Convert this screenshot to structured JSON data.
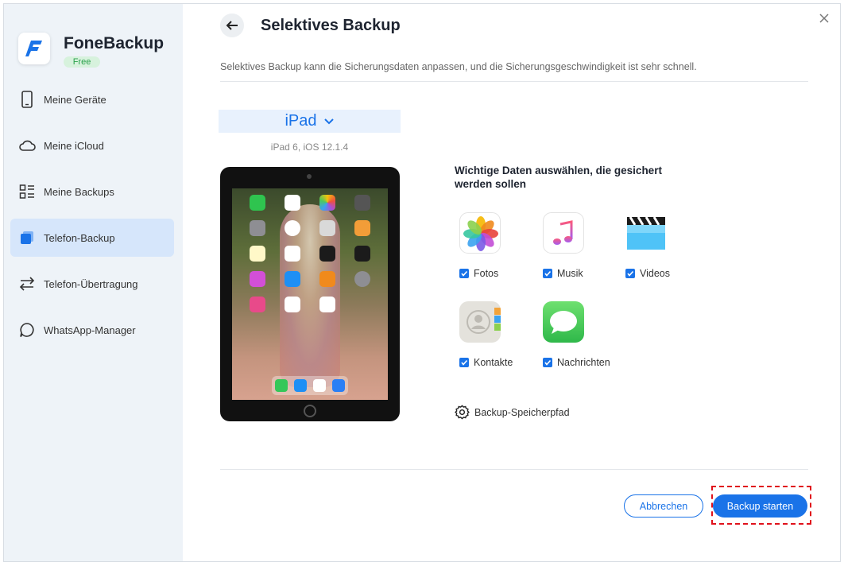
{
  "app": {
    "name": "FoneBackup",
    "badge": "Free"
  },
  "sidebar": {
    "items": [
      {
        "label": "Meine Geräte",
        "icon": "phone-icon",
        "active": false
      },
      {
        "label": "Meine iCloud",
        "icon": "cloud-icon",
        "active": false
      },
      {
        "label": "Meine Backups",
        "icon": "list-icon",
        "active": false
      },
      {
        "label": "Telefon-Backup",
        "icon": "backup-icon",
        "active": true
      },
      {
        "label": "Telefon-Übertragung",
        "icon": "transfer-icon",
        "active": false
      },
      {
        "label": "WhatsApp-Manager",
        "icon": "chat-icon",
        "active": false
      }
    ]
  },
  "header": {
    "title": "Selektives Backup",
    "subtitle": "Selektives Backup kann die Sicherungsdaten anpassen, und die Sicherungsgeschwindigkeit ist sehr schnell."
  },
  "device": {
    "name": "iPad",
    "info": "iPad 6, iOS 12.1.4"
  },
  "data_section": {
    "title": "Wichtige Daten auswählen, die gesichert werden sollen",
    "items": [
      {
        "label": "Fotos",
        "icon": "photos-icon",
        "checked": true
      },
      {
        "label": "Musik",
        "icon": "music-icon",
        "checked": true
      },
      {
        "label": "Videos",
        "icon": "videos-icon",
        "checked": true
      },
      {
        "label": "Kontakte",
        "icon": "contacts-icon",
        "checked": true
      },
      {
        "label": "Nachrichten",
        "icon": "messages-icon",
        "checked": true
      }
    ]
  },
  "storage": {
    "label": "Backup-Speicherpfad"
  },
  "buttons": {
    "cancel": "Abbrechen",
    "start": "Backup starten"
  },
  "colors": {
    "accent": "#1a73e8",
    "sidebar_bg": "#eef3f8",
    "active_bg": "#d6e6fb",
    "highlight": "#e0111b"
  }
}
